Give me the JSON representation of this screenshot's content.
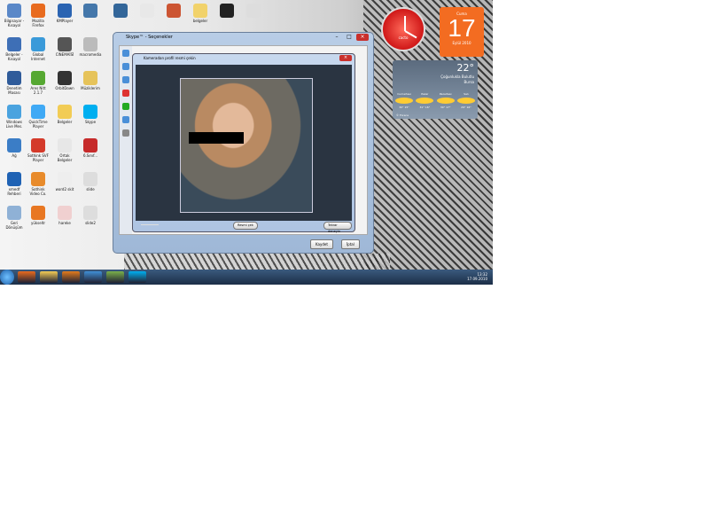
{
  "desktop": {
    "icons": [
      {
        "id": "bilgisayar",
        "label": "Bilgisayar -\nKısayol",
        "color": "#5a88c8"
      },
      {
        "id": "mozilla",
        "label": "Mozilla\nFirefox",
        "color": "#e86b1f"
      },
      {
        "id": "kmplayer",
        "label": "KMPlayer",
        "color": "#2b64b2"
      },
      {
        "id": "p3",
        "label": "",
        "color": "#4477aa"
      },
      {
        "id": "p4",
        "label": "",
        "color": "#336699"
      },
      {
        "id": "p5",
        "label": "",
        "color": "#e8e8e8"
      },
      {
        "id": "p6",
        "label": "",
        "color": "#cc5533"
      },
      {
        "id": "belgeler",
        "label": "belgeler",
        "color": "#f1d26b"
      },
      {
        "id": "p8",
        "label": "",
        "color": "#222"
      },
      {
        "id": "p9",
        "label": "",
        "color": "#ddd"
      },
      {
        "id": "belgeler2",
        "label": "Belgeler -\nKısayol",
        "color": "#3e6fb6"
      },
      {
        "id": "gelismis",
        "label": "Global\nInternet",
        "color": "#3a9ad9"
      },
      {
        "id": "cinema",
        "label": "CINEMAİSİ",
        "color": "#555"
      },
      {
        "id": "macromedia",
        "label": "macromedia",
        "color": "#bbb"
      },
      {
        "id": "c1",
        "label": "Denetim\nMasası",
        "color": "#2f5b9a"
      },
      {
        "id": "c2",
        "label": "Ares Nitt\n2.1.7",
        "color": "#56a832"
      },
      {
        "id": "c3",
        "label": "OrbitDown",
        "color": "#333"
      },
      {
        "id": "c4",
        "label": "Müziklerim",
        "color": "#e6c35a"
      },
      {
        "id": "d1",
        "label": "Windows\nLive Mes.",
        "color": "#4aa3df"
      },
      {
        "id": "d2",
        "label": "QuickTime\nPlayer",
        "color": "#3fa9f5"
      },
      {
        "id": "d3",
        "label": "Belgeler",
        "color": "#f2cc55"
      },
      {
        "id": "d4",
        "label": "Skype",
        "color": "#00aff0"
      },
      {
        "id": "e1",
        "label": "Ağ",
        "color": "#3b7dc6"
      },
      {
        "id": "e2",
        "label": "Sothink SVF\nPlayer",
        "color": "#d43a2a"
      },
      {
        "id": "e3",
        "label": "Ortak\nBelgeler",
        "color": "#e7e7e7"
      },
      {
        "id": "e4",
        "label": "6.Sınıf...",
        "color": "#c62b2b"
      },
      {
        "id": "f1",
        "label": "xmedf\nRehberi",
        "color": "#1f62b4"
      },
      {
        "id": "f2",
        "label": "Sothink\nVideo Co.",
        "color": "#e88b2b"
      },
      {
        "id": "f3",
        "label": "word2 skit",
        "color": "#eee"
      },
      {
        "id": "f4",
        "label": "slide",
        "color": "#ddd"
      },
      {
        "id": "g1",
        "label": "Geri\nDönüşüm",
        "color": "#8fb1d6"
      },
      {
        "id": "g2",
        "label": "yükseltr",
        "color": "#e87722"
      },
      {
        "id": "g3",
        "label": "hareke",
        "color": "#f0d0d0"
      },
      {
        "id": "g4",
        "label": "slide2",
        "color": "#ddd"
      }
    ]
  },
  "clock": {
    "brand": "cacto"
  },
  "calendar": {
    "day": "Cuma",
    "number": "17",
    "month": "Eylül 2010"
  },
  "weather": {
    "temp": "22°",
    "condition": "Çoğunlukla Bulutlu",
    "city": "Bursa",
    "source": "© Foreca",
    "days": [
      {
        "name": "Cumartesi",
        "hi": "30°",
        "lo": "15°"
      },
      {
        "name": "Pazar",
        "hi": "31°",
        "lo": "16°"
      },
      {
        "name": "Pazartesi",
        "hi": "30°",
        "lo": "17°"
      },
      {
        "name": "Salı",
        "hi": "29°",
        "lo": "16°"
      }
    ]
  },
  "skype_window": {
    "title": "Skype™ - Seçenekler",
    "save_label": "Kaydet",
    "cancel_label": "İptal"
  },
  "camera_dialog": {
    "title": "Kameradan profil resmi çekin",
    "capture_label": "Resmi çek",
    "retry_label": "Tekrar deneyin"
  },
  "taskbar": {
    "time": "13:32",
    "date": "17.09.2010",
    "items": [
      {
        "id": "firefox",
        "color": "#e86b1f"
      },
      {
        "id": "explorer",
        "color": "#f2cc55"
      },
      {
        "id": "media",
        "color": "#e27b1d"
      },
      {
        "id": "ie",
        "color": "#3f8fd6"
      },
      {
        "id": "network",
        "color": "#7ab04b"
      },
      {
        "id": "skype",
        "color": "#00aff0"
      }
    ]
  }
}
